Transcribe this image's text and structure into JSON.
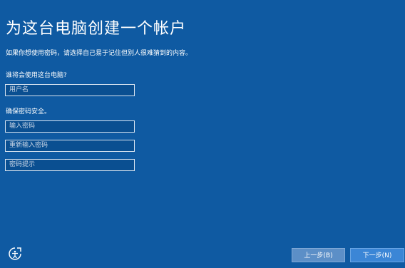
{
  "header": {
    "title": "为这台电脑创建一个帐户",
    "subtitle": "如果你想使用密码，请选择自己易于记住但别人很难猜到的内容。"
  },
  "user_section": {
    "label": "谁将会使用这台电脑?",
    "username_placeholder": "用户名"
  },
  "password_section": {
    "label": "确保密码安全。",
    "password_placeholder": "输入密码",
    "reenter_placeholder": "重新输入密码",
    "hint_placeholder": "密码提示"
  },
  "footer": {
    "back_label": "上一步(B)",
    "next_label": "下一步(N)"
  },
  "icons": {
    "accessibility": "accessibility-icon"
  },
  "colors": {
    "background": "#0f5aa2",
    "next_button": "#3b86d6",
    "back_button": "#5c8fc7"
  }
}
